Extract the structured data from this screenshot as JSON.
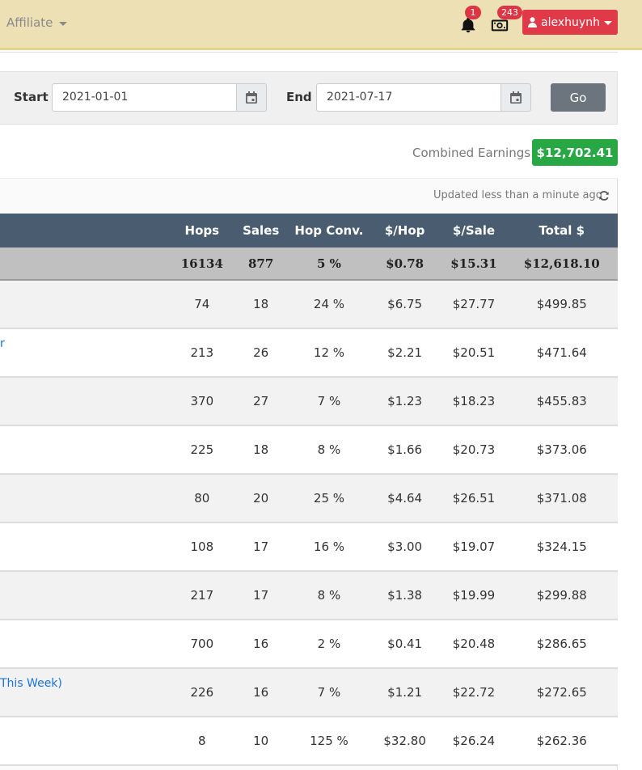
{
  "nav": {
    "affiliate_label": "Affiliate",
    "notif_count": "1",
    "cash_count": "243",
    "username": "alexhuynh"
  },
  "dates": {
    "start_label": "Start",
    "start_value": "2021-01-01",
    "end_label": "End",
    "end_value": "2021-07-17",
    "go_label": "Go"
  },
  "earnings": {
    "label": "Combined Earnings:",
    "value": "$12,702.41"
  },
  "table": {
    "updated": "Updated less than a minute ago",
    "headers": [
      "Hops",
      "Sales",
      "Hop Conv.",
      "$/Hop",
      "$/Sale",
      "Total $"
    ],
    "totals": [
      "16134",
      "877",
      "5 %",
      "$0.78",
      "$15.31",
      "$12,618.10"
    ],
    "rows": [
      {
        "name": "",
        "cells": [
          "74",
          "18",
          "24 %",
          "$6.75",
          "$27.77",
          "$499.85"
        ]
      },
      {
        "name": "r",
        "cells": [
          "213",
          "26",
          "12 %",
          "$2.21",
          "$20.51",
          "$471.64"
        ]
      },
      {
        "name": "",
        "cells": [
          "370",
          "27",
          "7 %",
          "$1.23",
          "$18.23",
          "$455.83"
        ]
      },
      {
        "name": "",
        "cells": [
          "225",
          "18",
          "8 %",
          "$1.66",
          "$20.73",
          "$373.06"
        ]
      },
      {
        "name": "",
        "cells": [
          "80",
          "20",
          "25 %",
          "$4.64",
          "$26.51",
          "$371.08"
        ]
      },
      {
        "name": "",
        "cells": [
          "108",
          "17",
          "16 %",
          "$3.00",
          "$19.07",
          "$324.15"
        ]
      },
      {
        "name": "",
        "cells": [
          "217",
          "17",
          "8 %",
          "$1.38",
          "$19.99",
          "$299.88"
        ]
      },
      {
        "name": "",
        "cells": [
          "700",
          "16",
          "2 %",
          "$0.41",
          "$20.48",
          "$286.65"
        ]
      },
      {
        "name": "This Week)",
        "cells": [
          "226",
          "16",
          "7 %",
          "$1.21",
          "$22.72",
          "$272.65"
        ]
      },
      {
        "name": "",
        "cells": [
          "8",
          "10",
          "125 %",
          "$32.80",
          "$26.24",
          "$262.36"
        ]
      }
    ]
  }
}
